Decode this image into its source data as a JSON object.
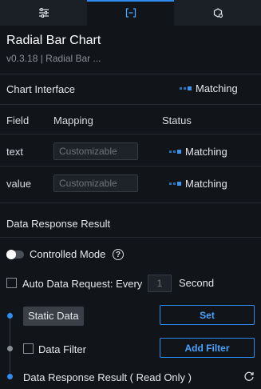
{
  "tabs": [
    {
      "name": "sliders-icon",
      "active": false
    },
    {
      "name": "bracket-interface-icon",
      "active": true
    },
    {
      "name": "interaction-icon",
      "active": false
    }
  ],
  "header": {
    "title": "Radial Bar Chart",
    "subtitle": "v0.3.18 | Radial Bar ..."
  },
  "chart_interface": {
    "label": "Chart Interface",
    "status": "Matching"
  },
  "field_table": {
    "headers": {
      "field": "Field",
      "mapping": "Mapping",
      "status": "Status"
    },
    "rows": [
      {
        "field": "text",
        "placeholder": "Customizable",
        "status": "Matching"
      },
      {
        "field": "value",
        "placeholder": "Customizable",
        "status": "Matching"
      }
    ]
  },
  "data_response": {
    "label": "Data Response Result",
    "controlled_mode_label": "Controlled Mode",
    "controlled_mode_on": false,
    "auto_request_label": "Auto Data Request: Every",
    "auto_request_value": "1",
    "auto_request_unit": "Second"
  },
  "pipeline": {
    "static_data_label": "Static Data",
    "set_button": "Set",
    "data_filter_label": "Data Filter",
    "add_filter_button": "Add Filter",
    "result_label": "Data Response Result ( Read Only )"
  },
  "colors": {
    "accent": "#2f8cf0",
    "background": "#111419",
    "tab_bar": "#1b1f26"
  }
}
